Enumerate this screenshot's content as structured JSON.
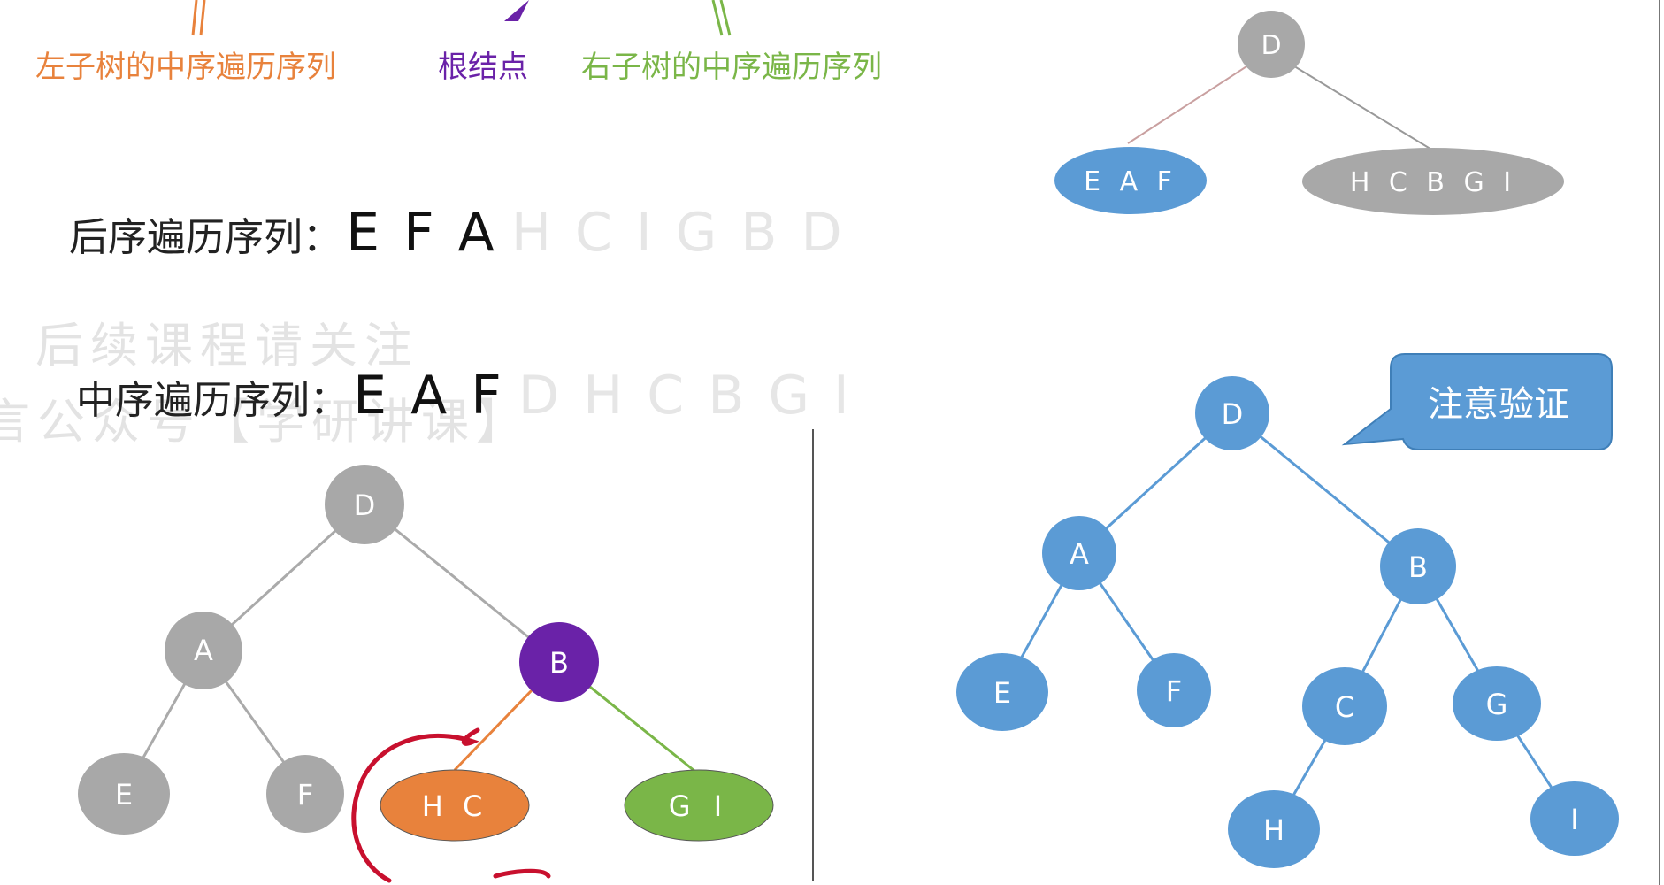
{
  "top_labels": {
    "left_inorder": "左子树的中序遍历序列",
    "root": "根结点",
    "right_inorder": "右子树的中序遍历序列"
  },
  "postorder": {
    "label": "后序遍历序列：",
    "highlight": "E F A",
    "rest": "H C I G B D"
  },
  "inorder": {
    "label": "中序遍历序列：",
    "highlight": "E A F",
    "rest": "D H C B G I"
  },
  "watermark": {
    "line1": "后续课程请关注",
    "line2": "言公众号【学研讲课】"
  },
  "callout": "注意验证",
  "tree_top": {
    "root": "D",
    "left": "E A F",
    "right": "H C B G I"
  },
  "tree_left": {
    "D": "D",
    "A": "A",
    "B": "B",
    "E": "E",
    "F": "F",
    "HC": "H C",
    "GI": "G I"
  },
  "tree_right": {
    "D": "D",
    "A": "A",
    "B": "B",
    "E": "E",
    "F": "F",
    "C": "C",
    "G": "G",
    "H": "H",
    "I": "I"
  },
  "colors": {
    "orange": "#e8823c",
    "purple": "#6a22a8",
    "green": "#7ab648",
    "gray": "#a8a8a8",
    "blue": "#5b9bd5",
    "red": "#c8102e"
  }
}
